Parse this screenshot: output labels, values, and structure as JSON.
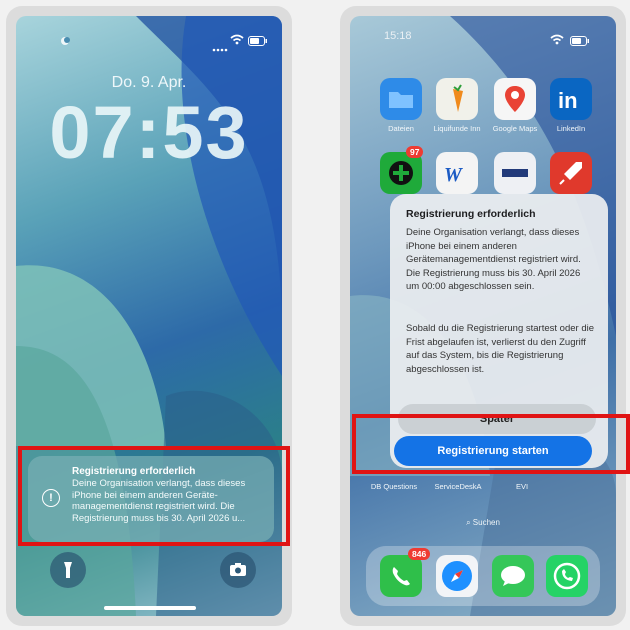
{
  "left": {
    "date": "Do. 9. Apr.",
    "time": "07:53",
    "notification": {
      "title": "Registrierung erforderlich",
      "body": "Deine Organisation verlangt, dass dieses iPhone bei einem anderen Geräte-managementdienst registriert wird. Die Registrierung muss bis 30. April 2026 u..."
    }
  },
  "right": {
    "status_time": "15:18",
    "apps": [
      {
        "label": "Dateien",
        "color": "#2e8be8"
      },
      {
        "label": "Liquifunde Inn",
        "color": "#f1f1ea"
      },
      {
        "label": "Google Maps",
        "color": "#f6f6f6"
      },
      {
        "label": "LinkedIn",
        "color": "#0a66c2"
      }
    ],
    "badge_97": "97",
    "dialog": {
      "title": "Registrierung erforderlich",
      "paragraph1": "Deine Organisation verlangt, dass dieses iPhone bei einem anderen Gerätemanagementdienst registriert wird. Die Registrierung muss bis 30. April 2026 um 00:00 abgeschlossen sein.",
      "paragraph2": "Sobald du die Registrierung startest oder die Frist abgelaufen ist, verlierst du den Zugriff auf das System, bis die Registrierung abgeschlossen ist.",
      "later": "Später",
      "start": "Registrierung starten"
    },
    "bottom_labels": [
      "DB Questions",
      "ServiceDeskA",
      "EVI"
    ],
    "search": "Suchen",
    "dock_badge": "846"
  }
}
